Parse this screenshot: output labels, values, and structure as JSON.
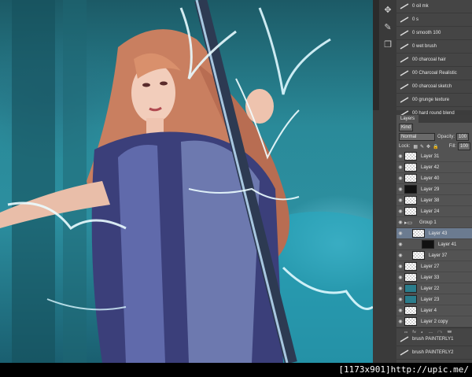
{
  "brush_presets": [
    {
      "name": "0 oil mk"
    },
    {
      "name": "0 s"
    },
    {
      "name": "0 smooth 100"
    },
    {
      "name": "0 wet brush"
    },
    {
      "name": "00 charcoal hair"
    },
    {
      "name": "00 Charcoal Realistic"
    },
    {
      "name": "00 charcoal sketch"
    },
    {
      "name": "00 grunge texture"
    },
    {
      "name": "00 hard round blend"
    },
    {
      "name": "00 hard round blend FX"
    },
    {
      "name": "00 hard round no blend"
    }
  ],
  "layers_panel": {
    "tab": "Layers",
    "filter_kind": "Kind",
    "blend_mode": "Normal",
    "opacity_label": "Opacity:",
    "opacity_value": "100",
    "lock_label": "Lock:",
    "fill_label": "Fill:",
    "fill_value": "100",
    "layers": [
      {
        "name": "Layer 31",
        "thumb": "checker"
      },
      {
        "name": "Layer 42",
        "thumb": "checker"
      },
      {
        "name": "Layer 40",
        "thumb": "checker"
      },
      {
        "name": "Layer 29",
        "thumb": "dark"
      },
      {
        "name": "Layer 38",
        "thumb": "checker"
      },
      {
        "name": "Layer 24",
        "thumb": "checker"
      },
      {
        "name": "Group 1",
        "thumb": "folder"
      },
      {
        "name": "Layer 43",
        "thumb": "checker"
      },
      {
        "name": "Layer 41",
        "thumb": "dark"
      },
      {
        "name": "Layer 37",
        "thumb": "checker"
      },
      {
        "name": "Layer 27",
        "thumb": "checker"
      },
      {
        "name": "Layer 33",
        "thumb": "checker"
      },
      {
        "name": "Layer 22",
        "thumb": "teal"
      },
      {
        "name": "Layer 23",
        "thumb": "teal"
      },
      {
        "name": "Layer 4",
        "thumb": "checker"
      },
      {
        "name": "Layer 2 copy",
        "thumb": "checker"
      }
    ]
  },
  "bottom_presets": [
    {
      "name": "brush PAINTERLY1"
    },
    {
      "name": "brush PAINTERLY2"
    },
    {
      "name": "brush PAINTERLY3"
    }
  ],
  "watermark": "[1173x901]http://upic.me/"
}
